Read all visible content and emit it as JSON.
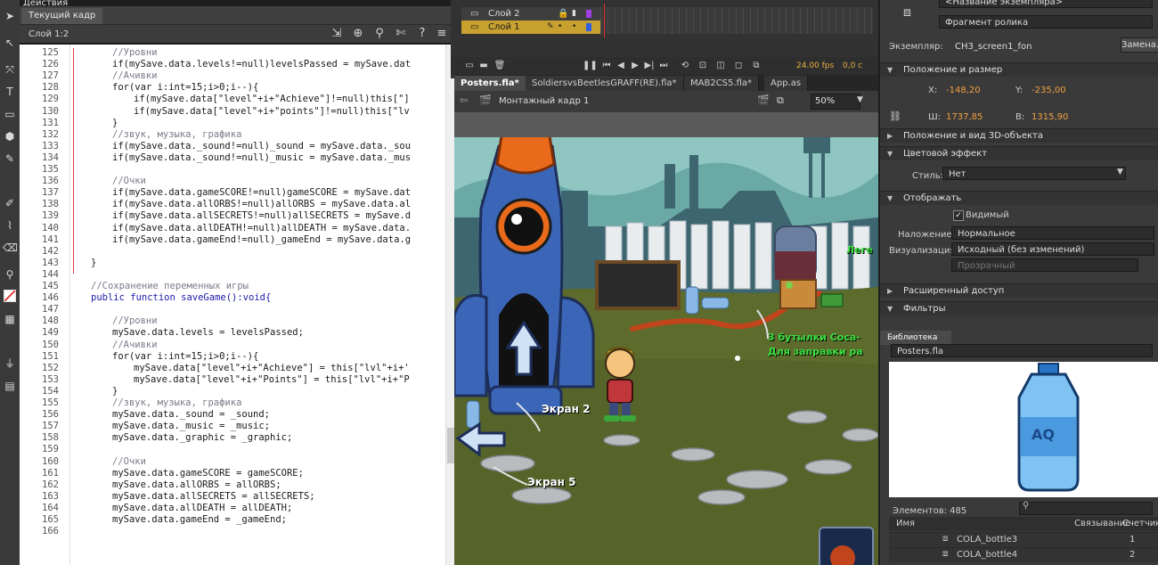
{
  "code_panel": {
    "header": "Действия",
    "tab": "Текущий кадр",
    "location": "Слой 1:2",
    "lines": [
      {
        "n": "125",
        "text": "//Уровни",
        "indent": 2,
        "cls": "com"
      },
      {
        "n": "126",
        "text": "if(mySave.data.levels!=null)levelsPassed = mySave.dat",
        "indent": 2,
        "cls": ""
      },
      {
        "n": "127",
        "text": "//Ачивки",
        "indent": 2,
        "cls": "com"
      },
      {
        "n": "128",
        "text": "for(var i:int=15;i>0;i--){",
        "indent": 2,
        "cls": ""
      },
      {
        "n": "129",
        "text": "if(mySave.data[\"level\"+i+\"Achieve\"]!=null)this[\"]",
        "indent": 3,
        "cls": ""
      },
      {
        "n": "130",
        "text": "if(mySave.data[\"level\"+i+\"points\"]!=null)this[\"lv",
        "indent": 3,
        "cls": ""
      },
      {
        "n": "131",
        "text": "}",
        "indent": 2,
        "cls": ""
      },
      {
        "n": "132",
        "text": "//звук, музыка, графика",
        "indent": 2,
        "cls": "com"
      },
      {
        "n": "133",
        "text": "if(mySave.data._sound!=null)_sound = mySave.data._sou",
        "indent": 2,
        "cls": ""
      },
      {
        "n": "134",
        "text": "if(mySave.data._sound!=null)_music = mySave.data._mus",
        "indent": 2,
        "cls": ""
      },
      {
        "n": "135",
        "text": "",
        "indent": 2,
        "cls": ""
      },
      {
        "n": "136",
        "text": "//Очки",
        "indent": 2,
        "cls": "com"
      },
      {
        "n": "137",
        "text": "if(mySave.data.gameSCORE!=null)gameSCORE = mySave.dat",
        "indent": 2,
        "cls": ""
      },
      {
        "n": "138",
        "text": "if(mySave.data.allORBS!=null)allORBS = mySave.data.al",
        "indent": 2,
        "cls": ""
      },
      {
        "n": "139",
        "text": "if(mySave.data.allSECRETS!=null)allSECRETS = mySave.d",
        "indent": 2,
        "cls": ""
      },
      {
        "n": "140",
        "text": "if(mySave.data.allDEATH!=null)allDEATH = mySave.data.",
        "indent": 2,
        "cls": ""
      },
      {
        "n": "141",
        "text": "if(mySave.data.gameEnd!=null)_gameEnd = mySave.data.g",
        "indent": 2,
        "cls": ""
      },
      {
        "n": "142",
        "text": "",
        "indent": 1,
        "cls": ""
      },
      {
        "n": "143",
        "text": "}",
        "indent": 1,
        "cls": ""
      },
      {
        "n": "144",
        "text": "",
        "indent": 1,
        "cls": ""
      },
      {
        "n": "145",
        "text": "//Сохранение переменных игры",
        "indent": 1,
        "cls": "com"
      },
      {
        "n": "146",
        "text": "public function saveGame():void{",
        "indent": 1,
        "cls": "kw"
      },
      {
        "n": "147",
        "text": "",
        "indent": 1,
        "cls": ""
      },
      {
        "n": "148",
        "text": "//Уровни",
        "indent": 2,
        "cls": "com"
      },
      {
        "n": "149",
        "text": "mySave.data.levels = levelsPassed;",
        "indent": 2,
        "cls": ""
      },
      {
        "n": "150",
        "text": "//Ачивки",
        "indent": 2,
        "cls": "com"
      },
      {
        "n": "151",
        "text": "for(var i:int=15;i>0;i--){",
        "indent": 2,
        "cls": ""
      },
      {
        "n": "152",
        "text": "mySave.data[\"level\"+i+\"Achieve\"] = this[\"lvl\"+i+'",
        "indent": 3,
        "cls": ""
      },
      {
        "n": "153",
        "text": "mySave.data[\"level\"+i+\"Points\"] = this[\"lvl\"+i+\"P",
        "indent": 3,
        "cls": ""
      },
      {
        "n": "154",
        "text": "}",
        "indent": 2,
        "cls": ""
      },
      {
        "n": "155",
        "text": "//звук, музыка, графика",
        "indent": 2,
        "cls": "com"
      },
      {
        "n": "156",
        "text": "mySave.data._sound = _sound;",
        "indent": 2,
        "cls": ""
      },
      {
        "n": "157",
        "text": "mySave.data._music = _music;",
        "indent": 2,
        "cls": ""
      },
      {
        "n": "158",
        "text": "mySave.data._graphic = _graphic;",
        "indent": 2,
        "cls": ""
      },
      {
        "n": "159",
        "text": "",
        "indent": 2,
        "cls": ""
      },
      {
        "n": "160",
        "text": "//Очки",
        "indent": 2,
        "cls": "com"
      },
      {
        "n": "161",
        "text": "mySave.data.gameSCORE = gameSCORE;",
        "indent": 2,
        "cls": ""
      },
      {
        "n": "162",
        "text": "mySave.data.allORBS = allORBS;",
        "indent": 2,
        "cls": ""
      },
      {
        "n": "163",
        "text": "mySave.data.allSECRETS = allSECRETS;",
        "indent": 2,
        "cls": ""
      },
      {
        "n": "164",
        "text": "mySave.data.allDEATH = allDEATH;",
        "indent": 2,
        "cls": ""
      },
      {
        "n": "165",
        "text": "mySave.data.gameEnd = _gameEnd;",
        "indent": 2,
        "cls": ""
      },
      {
        "n": "166",
        "text": "",
        "indent": 2,
        "cls": ""
      }
    ]
  },
  "timeline": {
    "layers": [
      "Слой 2",
      "Слой 1"
    ],
    "time_readout": "24.00 fps",
    "frame_readout": "0,0 с"
  },
  "document": {
    "tabs": [
      "Posters.fla*",
      "SoldiersvsBeetlesGRAFF(RE).fla*",
      "MAB2CS5.fla*",
      "App.as"
    ],
    "scene": "Монтажный кадр 1",
    "zoom": "50%",
    "stage_labels": {
      "screen2": "Экран 2",
      "screen5": "Экран 5",
      "note_line1": "3 бутылки Coca-",
      "note_line2": "Для заправки ра",
      "legend_fragment": "Леге"
    }
  },
  "properties": {
    "top_name": "<Название экземпляра>",
    "type": "Фрагмент ролика",
    "instance_label": "Экземпляр:",
    "instance_value": "CH3_screen1_fon",
    "swap_button": "Замена...",
    "sections": {
      "position": "Положение и размер",
      "3d": "Положение и вид 3D-объекта",
      "color": "Цветовой эффект",
      "display": "Отображать",
      "access": "Расширенный доступ",
      "filters": "Фильтры"
    },
    "x_label": "X:",
    "x_value": "-148,20",
    "y_label": "Y:",
    "y_value": "-235,00",
    "w_label": "Ш:",
    "w_value": "1737,85",
    "h_label": "В:",
    "h_value": "1315,90",
    "style_label": "Стиль:",
    "style_value": "Нет",
    "visible_label": "Видимый",
    "blend_label": "Наложение:",
    "blend_value": "Нормальное",
    "render_label": "Визуализация:",
    "render_value": "Исходный (без изменений)",
    "transparent_value": "Прозрачный"
  },
  "library": {
    "tab": "Библиотека",
    "file": "Posters.fla",
    "preview_label": "AQ",
    "count": "Элементов: 485",
    "columns": {
      "name": "Имя",
      "linkage": "Связывание",
      "count": "Счетчик"
    },
    "items": [
      {
        "name": "COLA_bottle3",
        "count": "1"
      },
      {
        "name": "COLA_bottle4",
        "count": "2"
      }
    ]
  },
  "colors": {
    "accent_orange": "#f0a040",
    "comment": "#7a7a8a",
    "keyword": "#1a1aaa",
    "layer_selected": "#c8a030",
    "note_green": "#3be040"
  }
}
